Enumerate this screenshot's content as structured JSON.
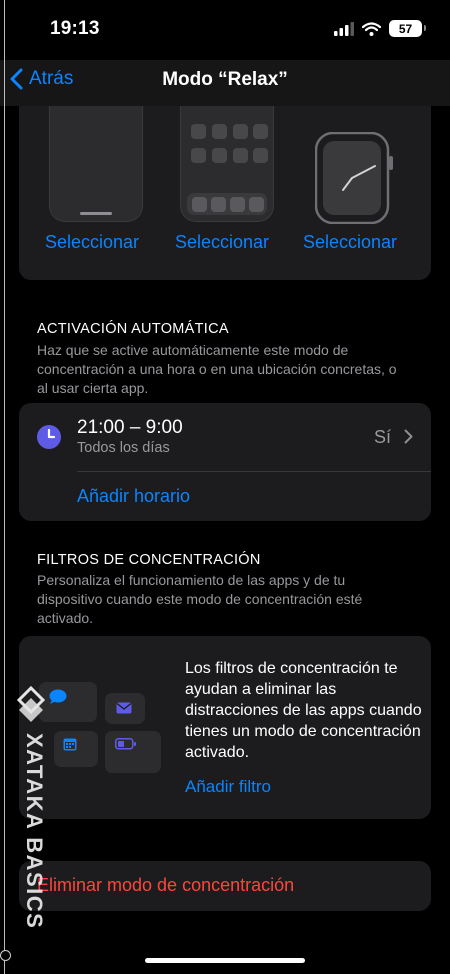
{
  "status_bar": {
    "time": "19:13",
    "battery": "57"
  },
  "nav": {
    "back_label": "Atrás",
    "title": "Modo “Relax”"
  },
  "screens": {
    "select_1": "Seleccionar",
    "select_2": "Seleccionar",
    "select_3": "Seleccionar"
  },
  "auto_activation": {
    "title": "ACTIVACIÓN AUTOMÁTICA",
    "description": "Haz que se active automáticamente este modo de concentración a una hora o en una ubicación concretas, o al usar cierta app.",
    "schedule": {
      "time": "21:00 – 9:00",
      "days": "Todos los días",
      "value": "Sí"
    },
    "add_schedule": "Añadir horario"
  },
  "focus_filters": {
    "title": "FILTROS DE CONCENTRACIÓN",
    "description": "Personaliza el funcionamiento de las apps y de tu dispositivo cuando este modo de concentración esté activado.",
    "info": "Los filtros de concentración te ayudan a eliminar las distracciones de las apps cuando tienes un modo de concentración activado.",
    "add_filter": "Añadir filtro"
  },
  "delete_focus": "Eliminar modo de concentración",
  "watermark": "XATAKA BASICS",
  "colors": {
    "accent": "#0a84ff",
    "destructive": "#ff453a",
    "clock": "#5e5ce6",
    "card": "#1c1c1e"
  },
  "icons": [
    "signal-icon",
    "wifi-icon",
    "battery-icon",
    "back-chevron-icon",
    "clock-icon",
    "chevron-right-icon",
    "message-icon",
    "mail-icon",
    "calendar-icon",
    "battery-small-icon"
  ]
}
